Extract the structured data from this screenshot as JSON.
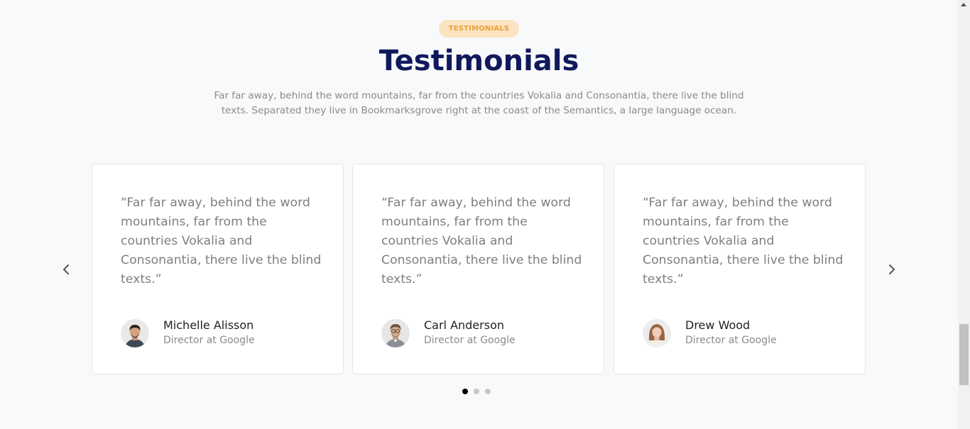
{
  "section": {
    "badge": "TESTIMONIALS",
    "title": "Testimonials",
    "subtitle_line1": "Far far away, behind the word mountains, far from the countries Vokalia and Consonantia, there live the blind",
    "subtitle_line2": "texts. Separated they live in Bookmarksgrove right at the coast of the Semantics, a large language ocean."
  },
  "testimonials": [
    {
      "quote": "“Far far away, behind the word mountains, far from the countries Vokalia and Consonantia, there live the blind texts.”",
      "name": "Michelle Alisson",
      "role": "Director at Google"
    },
    {
      "quote": "“Far far away, behind the word mountains, far from the countries Vokalia and Consonantia, there live the blind texts.”",
      "name": "Carl Anderson",
      "role": "Director at Google"
    },
    {
      "quote": "“Far far away, behind the word mountains, far from the countries Vokalia and Consonantia, there live the blind texts.”",
      "name": "Drew Wood",
      "role": "Director at Google"
    }
  ],
  "carousel": {
    "prev_icon": "chevron-left-icon",
    "next_icon": "chevron-right-icon",
    "page_count": 3,
    "active_page": 1
  },
  "colors": {
    "badge_bg": "#fce3c1",
    "badge_text": "#e9a13b",
    "title": "#10195c",
    "background": "#f8f9fb"
  }
}
